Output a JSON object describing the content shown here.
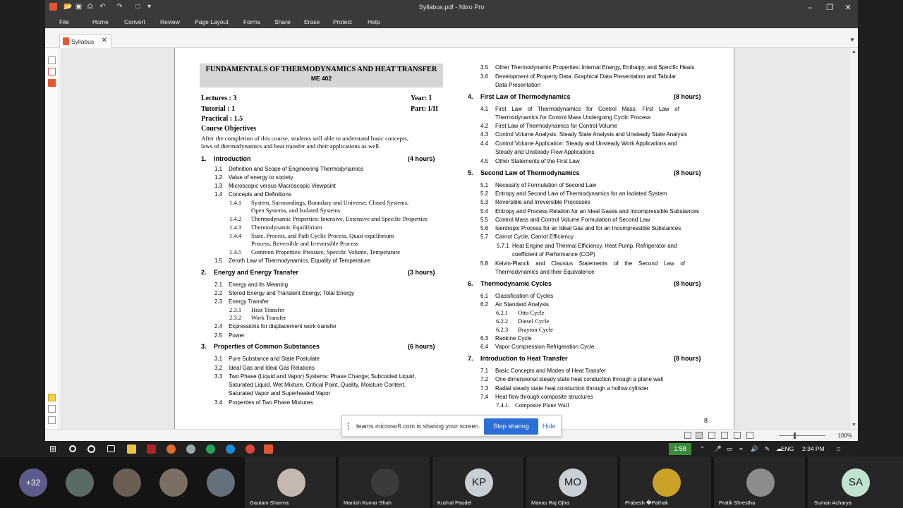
{
  "window": {
    "title": "Syllabus.pdf - Nitro Pro",
    "controls": [
      "–",
      "❐",
      "✕"
    ]
  },
  "ribbon": {
    "file": "File",
    "tabs": [
      "Home",
      "Convert",
      "Review",
      "Page Layout",
      "Forms",
      "Share",
      "Erase",
      "Protect",
      "Help"
    ]
  },
  "tab": {
    "label": "Syllabus",
    "close": "✕"
  },
  "doc": {
    "header_title": "FUNDAMENTALS OF THERMODYNAMICS AND HEAT TRANSFER",
    "header_code": "ME 402",
    "lectures": "Lectures    :  3",
    "tutorial": "Tutorial     :  1",
    "practical": "Practical   :  1.5",
    "year": "Year: I",
    "part": "Part: I/II",
    "objectives_title": "Course Objectives",
    "objectives_text_1": "After the completion of this course, students will able to understand basic concepts,",
    "objectives_text_2": "laws of thermodynamics and heat transfer and their applications as well.",
    "page_number": "8",
    "sections": {
      "s1": {
        "num": "1.",
        "title": "Introduction",
        "hours": "(4 hours)"
      },
      "s2": {
        "num": "2.",
        "title": "Energy and Energy Transfer",
        "hours": "(3 hours)"
      },
      "s3": {
        "num": "3.",
        "title": "Properties of Common Substances",
        "hours": "(6 hours)"
      },
      "s4": {
        "num": "4.",
        "title": "First Law of Thermodynamics",
        "hours": "(8 hours)"
      },
      "s5": {
        "num": "5.",
        "title": "Second Law of Thermodynamics",
        "hours": "(8 hours)"
      },
      "s6": {
        "num": "6.",
        "title": "Thermodynamic Cycles",
        "hours": "(8 hours)"
      },
      "s7": {
        "num": "7.",
        "title": "Introduction to Heat Transfer",
        "hours": "(8 hours)"
      }
    },
    "items": {
      "i1_1": [
        "1.1",
        "Definition and Scope of Engineering Thermodynamics"
      ],
      "i1_2": [
        "1.2",
        "Value of energy to society"
      ],
      "i1_3": [
        "1.3",
        "Microscopic versus Macroscopic Viewpoint"
      ],
      "i1_4": [
        "1.4",
        "Concepts and Definitions"
      ],
      "i1_4_1": [
        "1.4.1",
        "System, Surroundings, Boundary and Universe; Closed Systems,",
        "Open Systems, and Isolated Systems"
      ],
      "i1_4_2": [
        "1.4.2",
        "Thermodynamic Properties: Intensive, Extensive and Specific Properties"
      ],
      "i1_4_3": [
        "1.4.3",
        "Thermodynamic Equilibrium"
      ],
      "i1_4_4": [
        "1.4.4",
        "State, Process, and Path Cyclic Process, Quasi-equilibrium",
        "Process, Reversible and Irreversible Process"
      ],
      "i1_4_5": [
        "1.4.5",
        "Common Properties: Pressure, Specific Volume, Temperature"
      ],
      "i1_5": [
        "1.5",
        "Zeroth Law of Thermodynamics, Equality of Temperature"
      ],
      "i2_1": [
        "2.1",
        "Energy and its Meaning"
      ],
      "i2_2": [
        "2.2",
        "Stored Energy and Transient Energy; Total Energy"
      ],
      "i2_3": [
        "2.3",
        "Energy Transfer"
      ],
      "i2_3_1": [
        "2.3.1",
        "Heat Transfer"
      ],
      "i2_3_2": [
        "2.3.2",
        "Work Transfer"
      ],
      "i2_4": [
        "2.4",
        "Expressions for displacement work transfer"
      ],
      "i2_5": [
        "2.5",
        "Power"
      ],
      "i3_1": [
        "3.1",
        "Pure Substance and State Postulate"
      ],
      "i3_2": [
        "3.2",
        "Ideal Gas and Ideal Gas Relations"
      ],
      "i3_3": [
        "3.3",
        "Two Phase (Liquid and Vapor) Systems: Phase Change; Subcooled Liquid,",
        "Saturated Liquid, Wet Mixture, Critical Point, Quality, Moisture Content,",
        "Saturated Vapor and Superheated Vapor"
      ],
      "i3_4": [
        "3.4",
        "Properties of Two Phase Mixtures"
      ],
      "i3_5": [
        "3.5",
        "Other Thermodynamic Properties: Internal Energy, Enthalpy, and Specific Heats"
      ],
      "i3_6": [
        "3.6",
        "Development of Property Data: Graphical Data Presentation and Tabular",
        "Data Presentation"
      ],
      "i4_1": [
        "4.1",
        "First Law of Thermodynamics for Control Mass; First Law of",
        "Thermodynamics for Control Mass Undergoing Cyclic Process"
      ],
      "i4_2": [
        "4.2",
        "First Law of Thermodynamics for Control Volume"
      ],
      "i4_3": [
        "4.3",
        "Control Volume Analysis: Steady State Analysis and Unsteady State Analysis"
      ],
      "i4_4": [
        "4.4",
        "Control Volume Application: Steady and Unsteady Work Applications and",
        "Steady and Unsteady Flow Applications"
      ],
      "i4_5": [
        "4.5",
        "Other Statements of the First Law"
      ],
      "i5_1": [
        "5.1",
        "Necessity of Formulation of Second Law"
      ],
      "i5_2": [
        "5.2",
        "Entropy and Second Law of Thermodynamics for an Isolated System"
      ],
      "i5_3": [
        "5.3",
        "Reversible and Irreversible Processes"
      ],
      "i5_4": [
        "5.4",
        "Entropy and Process Relation for an Ideal Gases and Incompressible Substances"
      ],
      "i5_5": [
        "5.5",
        "Control Mass and Control Volume Formulation of Second Law"
      ],
      "i5_6": [
        "5.6",
        "Isentropic Process for an Ideal Gas and for an Incompressible Substances"
      ],
      "i5_7": [
        "5.7",
        "Carnot Cycle, Carnot Efficiency"
      ],
      "i5_7_1": [
        "5.7.1",
        "Heat Engine and Thermal Efficiency, Heat Pump, Refrigerator and",
        "coefficient of Performance (COP)"
      ],
      "i5_8": [
        "5.8",
        "Kelvin-Planck and Clausius Statements of the Second Law of",
        "Thermodynamics and their Equivalence"
      ],
      "i6_1": [
        "6.1",
        "Classification of Cycles"
      ],
      "i6_2": [
        "6.2",
        "Air Standard Analysis"
      ],
      "i6_2_1": [
        "6.2.1",
        "Otto Cycle"
      ],
      "i6_2_2": [
        "6.2.2",
        "Diesel Cycle"
      ],
      "i6_2_3": [
        "6.2.3",
        "Brayton Cycle"
      ],
      "i6_3": [
        "6.3",
        "Rankine Cycle"
      ],
      "i6_4": [
        "6.4",
        "Vapor Compression Refrigeration Cycle"
      ],
      "i7_1": [
        "7.1",
        "Basic Concepts and Modes of Heat Transfer"
      ],
      "i7_2": [
        "7.2",
        "One dimensional steady state heat conduction through a plane wall"
      ],
      "i7_3": [
        "7.3",
        "Radial steady state heat conduction through a hollow cylinder"
      ],
      "i7_4": [
        "7.4",
        "Heat flow through composite structures"
      ],
      "i7_4_1": [
        "7.4.1.",
        "Composite Plane Wall"
      ]
    }
  },
  "share_banner": {
    "message": "teams.microsoft.com is sharing your screen.",
    "stop": "Stop sharing",
    "hide": "Hide"
  },
  "statusbar": {
    "zoom": "100%"
  },
  "taskbar": {
    "timer": "1:58",
    "lang": "ENG",
    "time": "2:34 PM"
  },
  "participants": {
    "overflow": "+32",
    "tiles": [
      {
        "name": "Gautam Sharma"
      },
      {
        "name": "Manish Kumar Shah"
      },
      {
        "name": "Kushal Paudel",
        "initials": "KP"
      },
      {
        "name": "Manas Raj Ojha",
        "initials": "MO"
      },
      {
        "name": "Prabesh �Pathak"
      },
      {
        "name": "Pratik Shrestha"
      },
      {
        "name": "Suman Acharya",
        "initials": "SA"
      }
    ]
  },
  "colors": {
    "accent": "#2b6fd6",
    "timer": "#3b8a3b",
    "app_bar": "#3a3a3a"
  }
}
